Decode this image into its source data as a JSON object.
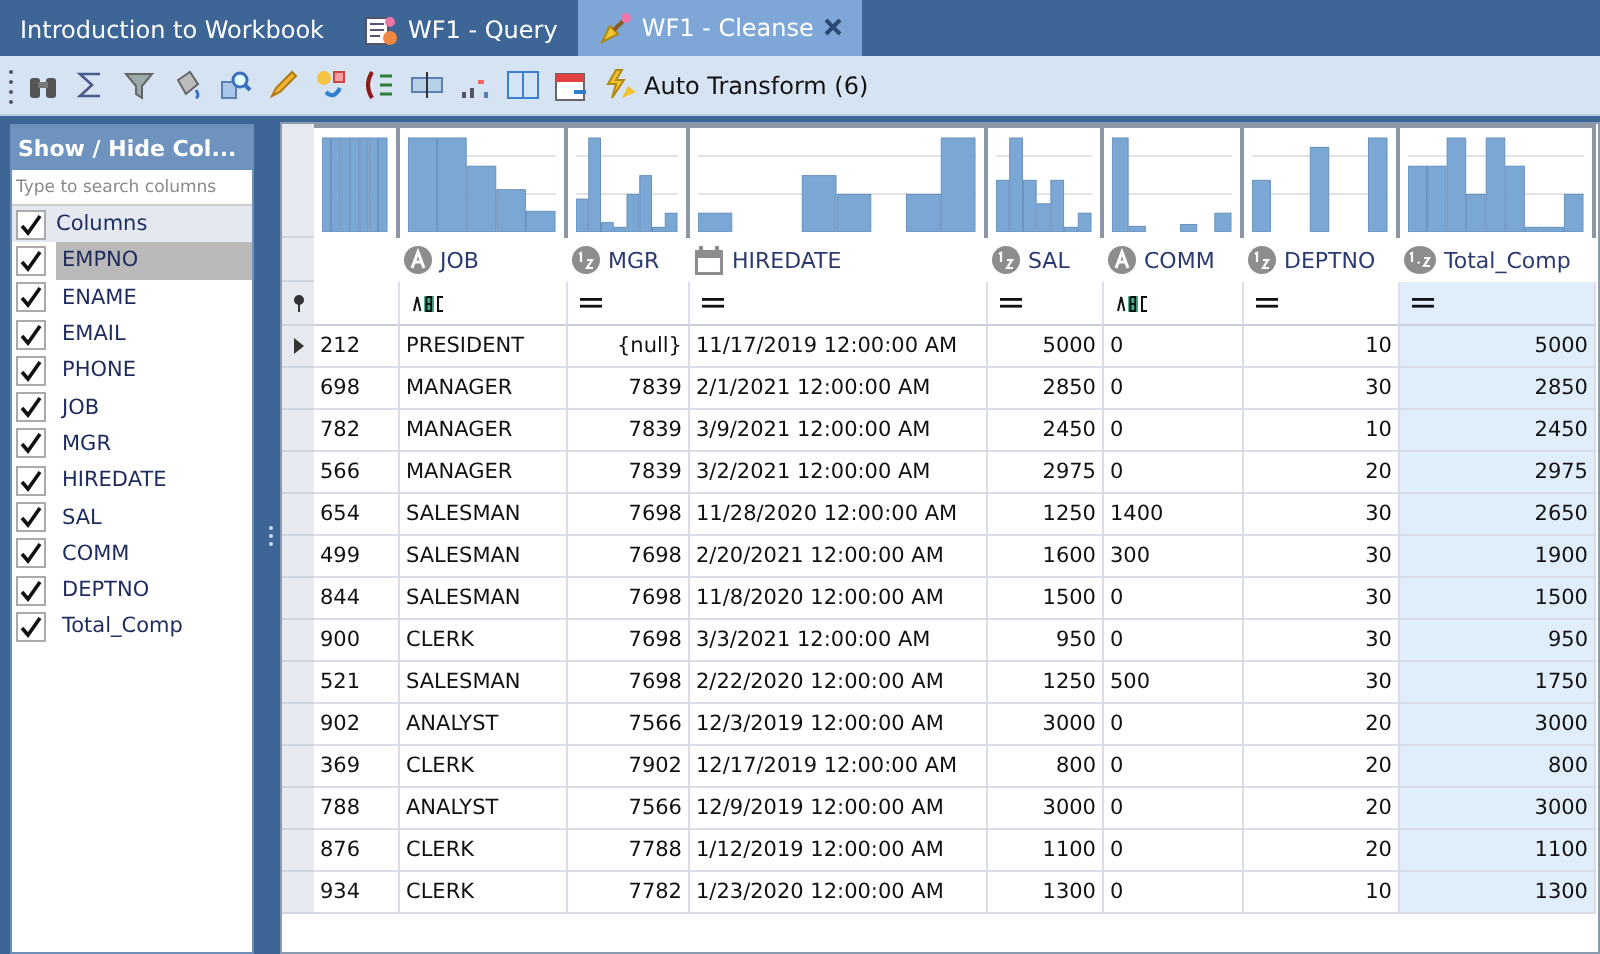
{
  "tabs": [
    {
      "label": "Introduction to Workbook",
      "selected": false
    },
    {
      "label": "WF1 - Query",
      "selected": false
    },
    {
      "label": "WF1 - Cleanse",
      "selected": true
    }
  ],
  "toolbar": {
    "auto_transform": "Auto Transform (6)"
  },
  "column_panel": {
    "title": "Show / Hide Col...",
    "search_placeholder": "Type to search columns",
    "header": {
      "label": "Columns",
      "checked": true
    },
    "items": [
      {
        "label": "EMPNO",
        "checked": true,
        "selected": true
      },
      {
        "label": "ENAME",
        "checked": true,
        "selected": false
      },
      {
        "label": "EMAIL",
        "checked": true,
        "selected": false
      },
      {
        "label": "PHONE",
        "checked": true,
        "selected": false
      },
      {
        "label": "JOB",
        "checked": true,
        "selected": false
      },
      {
        "label": "MGR",
        "checked": true,
        "selected": false
      },
      {
        "label": "HIREDATE",
        "checked": true,
        "selected": false
      },
      {
        "label": "SAL",
        "checked": true,
        "selected": false
      },
      {
        "label": "COMM",
        "checked": true,
        "selected": false
      },
      {
        "label": "DEPTNO",
        "checked": true,
        "selected": false
      },
      {
        "label": "Total_Comp",
        "checked": true,
        "selected": false
      }
    ]
  },
  "grid": {
    "columns": [
      {
        "kind": "none",
        "selected": false
      },
      {
        "label": "JOB",
        "kind": "text",
        "selected": false
      },
      {
        "label": "MGR",
        "kind": "int",
        "selected": false
      },
      {
        "label": "HIREDATE",
        "kind": "date",
        "selected": false
      },
      {
        "label": "SAL",
        "kind": "int",
        "selected": false
      },
      {
        "label": "COMM",
        "kind": "text",
        "selected": false
      },
      {
        "label": "DEPTNO",
        "kind": "int",
        "selected": false
      },
      {
        "label": "Total_Comp",
        "kind": "decimal",
        "selected": true
      }
    ],
    "rows": [
      {
        "current": true,
        "cells": [
          "212",
          "PRESIDENT",
          "{null}",
          "11/17/2019 12:00:00 AM",
          "5000",
          "0",
          "10",
          "5000"
        ]
      },
      {
        "current": false,
        "cells": [
          "698",
          "MANAGER",
          "7839",
          "2/1/2021 12:00:00 AM",
          "2850",
          "0",
          "30",
          "2850"
        ]
      },
      {
        "current": false,
        "cells": [
          "782",
          "MANAGER",
          "7839",
          "3/9/2021 12:00:00 AM",
          "2450",
          "0",
          "10",
          "2450"
        ]
      },
      {
        "current": false,
        "cells": [
          "566",
          "MANAGER",
          "7839",
          "3/2/2021 12:00:00 AM",
          "2975",
          "0",
          "20",
          "2975"
        ]
      },
      {
        "current": false,
        "cells": [
          "654",
          "SALESMAN",
          "7698",
          "11/28/2020 12:00:00 AM",
          "1250",
          "1400",
          "30",
          "2650"
        ]
      },
      {
        "current": false,
        "cells": [
          "499",
          "SALESMAN",
          "7698",
          "2/20/2021 12:00:00 AM",
          "1600",
          "300",
          "30",
          "1900"
        ]
      },
      {
        "current": false,
        "cells": [
          "844",
          "SALESMAN",
          "7698",
          "11/8/2020 12:00:00 AM",
          "1500",
          "0",
          "30",
          "1500"
        ]
      },
      {
        "current": false,
        "cells": [
          "900",
          "CLERK",
          "7698",
          "3/3/2021 12:00:00 AM",
          "950",
          "0",
          "30",
          "950"
        ]
      },
      {
        "current": false,
        "cells": [
          "521",
          "SALESMAN",
          "7698",
          "2/22/2020 12:00:00 AM",
          "1250",
          "500",
          "30",
          "1750"
        ]
      },
      {
        "current": false,
        "cells": [
          "902",
          "ANALYST",
          "7566",
          "12/3/2019 12:00:00 AM",
          "3000",
          "0",
          "20",
          "3000"
        ]
      },
      {
        "current": false,
        "cells": [
          "369",
          "CLERK",
          "7902",
          "12/17/2019 12:00:00 AM",
          "800",
          "0",
          "20",
          "800"
        ]
      },
      {
        "current": false,
        "cells": [
          "788",
          "ANALYST",
          "7566",
          "12/9/2019 12:00:00 AM",
          "3000",
          "0",
          "20",
          "3000"
        ]
      },
      {
        "current": false,
        "cells": [
          "876",
          "CLERK",
          "7788",
          "1/12/2019 12:00:00 AM",
          "1100",
          "0",
          "20",
          "1100"
        ]
      },
      {
        "current": false,
        "cells": [
          "934",
          "CLERK",
          "7782",
          "1/23/2020 12:00:00 AM",
          "1300",
          "0",
          "10",
          "1300"
        ]
      }
    ]
  }
}
